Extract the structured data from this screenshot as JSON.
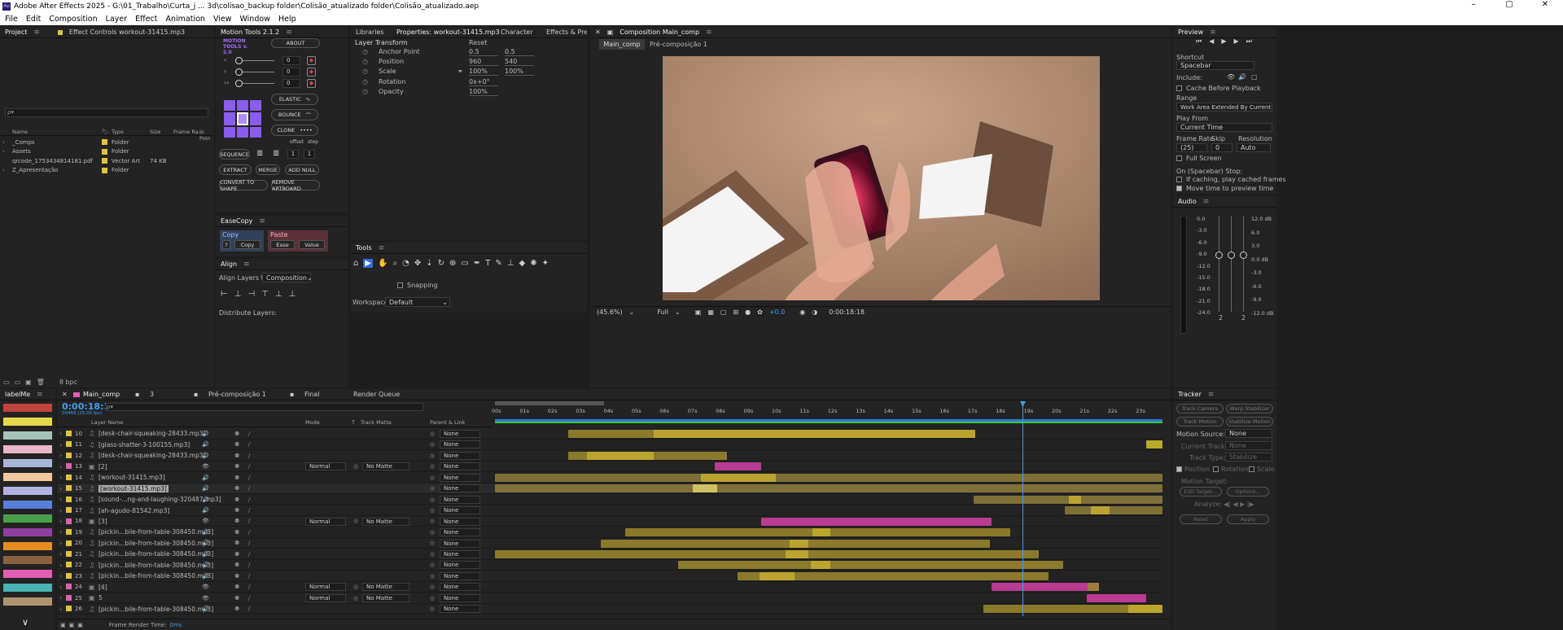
{
  "window": {
    "title": "Adobe After Effects 2025 - G:\\01_Trabalho\\Curta_j ... 3d\\colisao_backup folder\\Colisão_atualizado folder\\Colisão_atualizado.aep",
    "minimize": "–",
    "maximize": "▢",
    "close": "✕"
  },
  "menu": [
    "File",
    "Edit",
    "Composition",
    "Layer",
    "Effect",
    "Animation",
    "View",
    "Window",
    "Help"
  ],
  "project": {
    "tab": "Project",
    "tab2": "Effect Controls workout-31415.mp3",
    "search_placeholder": "ρ▾",
    "cols": [
      "Name",
      "Type",
      "Size",
      "Frame Ra...",
      "In Poin"
    ],
    "items": [
      {
        "name": "_Comps",
        "type": "Folder",
        "size": "",
        "color": "#e2c33a"
      },
      {
        "name": "Assets",
        "type": "Folder",
        "size": "",
        "color": "#e2c33a"
      },
      {
        "name": "qrcode_1753434814181.pdf",
        "type": "Vector Art",
        "size": "74 KB",
        "color": "#e2c33a"
      },
      {
        "name": "Z_Apresentação",
        "type": "Folder",
        "size": "",
        "color": "#e2c33a"
      }
    ],
    "bpc": "8 bpc"
  },
  "motion_tools": {
    "tab": "Motion Tools 2.1.2",
    "logo": "MOTION TOOLS v. 2.0",
    "about": "ABOUT",
    "val": "0",
    "elastic": "ELASTIC",
    "bounce": "BOUNCE",
    "clone": "CLONE",
    "offset": "offset",
    "step": "step",
    "sequence": "SEQUENCE",
    "one": "1",
    "extract": "EXTRACT",
    "merge": "MERGE",
    "add_null": "ADD NULL",
    "convert": "CONVERT TO SHAPE",
    "remove": "REMOVE ARTBOARD"
  },
  "easecopy": {
    "tab": "EaseCopy",
    "copy": "Copy",
    "q": "?",
    "copy_btn": "Copy",
    "paste": "Paste",
    "ease": "Ease",
    "value": "Value"
  },
  "align": {
    "tab": "Align",
    "align_to": "Align Layers to:",
    "target": "Composition",
    "distribute": "Distribute Layers:"
  },
  "properties": {
    "tabs": [
      "Libraries",
      "Properties: workout-31415.mp3",
      "Character",
      "Effects & Presets"
    ],
    "section": "Layer Transform",
    "reset": "Reset",
    "rows": [
      {
        "label": "Anchor Point",
        "v1": "0.5",
        "v2": "0.5"
      },
      {
        "label": "Position",
        "v1": "960",
        "v2": "540"
      },
      {
        "label": "Scale",
        "v1": "100%",
        "v2": "100%"
      },
      {
        "label": "Rotation",
        "v1": "0x+0°",
        "v2": ""
      },
      {
        "label": "Opacity",
        "v1": "100%",
        "v2": ""
      }
    ]
  },
  "tools": {
    "tab": "Tools",
    "snapping": "Snapping",
    "workspace_label": "Workspace:",
    "workspace": "Default"
  },
  "composition": {
    "tab": "Composition Main_comp",
    "crumb1": "Main_comp",
    "crumb2": "Pré-composição 1",
    "zoom": "(45.6%)",
    "res": "Full",
    "exposure": "+0.0",
    "time": "0:00:18:18"
  },
  "preview": {
    "tab": "Preview",
    "shortcut_label": "Shortcut",
    "shortcut": "Spacebar",
    "include": "Include:",
    "cache": "Cache Before Playback",
    "range_label": "Range",
    "range": "Work Area Extended By Current...",
    "playfrom_label": "Play From",
    "playfrom": "Current Time",
    "fr_label": "Frame Rate",
    "skip_label": "Skip",
    "res_label": "Resolution",
    "fr": "(25)",
    "skip": "0",
    "res": "Auto",
    "fullscreen": "Full Screen",
    "stop_label": "On (Spacebar) Stop:",
    "if_caching": "If caching, play cached frames",
    "move_time": "Move time to preview time"
  },
  "audio": {
    "tab": "Audio",
    "left": [
      "0.0",
      "-3.0",
      "-6.0",
      "-9.0",
      "-12.0",
      "-15.0",
      "-18.0",
      "-21.0",
      "-24.0"
    ],
    "right": [
      "12.0 dB",
      "6.0",
      "3.0",
      "0.0 dB",
      "-3.0",
      "-6.0",
      "-9.0",
      "-12.0 dB"
    ],
    "ch1": "2",
    "ch2": "2"
  },
  "tracker": {
    "tab": "Tracker",
    "track_camera": "Track Camera",
    "warp": "Warp Stabilizer",
    "track_motion": "Track Motion",
    "stabilize": "Stabilize Motion",
    "source_label": "Motion Source:",
    "source": "None",
    "current_label": "Current Track:",
    "current": "None",
    "type_label": "Track Type:",
    "type": "Stabilize",
    "position": "Position",
    "rotation": "Rotation",
    "scale": "Scale",
    "target": "Motion Target:",
    "edit_target": "Edit Target...",
    "options": "Options...",
    "analyze": "Analyze:",
    "reset": "Reset",
    "apply": "Apply"
  },
  "labels": {
    "tab": "labelMe",
    "colors": [
      "#c2423e",
      "#e5d84a",
      "#a6c3b8",
      "#e8b8c6",
      "#a9b7d6",
      "#f1c79e",
      "#b2b2e2",
      "#5a7edb",
      "#4a9f4a",
      "#8f3fa0",
      "#e48e22",
      "#8a6140",
      "#e25eb5",
      "#4ab3b5",
      "#b09470"
    ]
  },
  "timeline": {
    "tabs": [
      "Main_comp",
      "3",
      "Pré-composição 1",
      "Final",
      "Render Queue"
    ],
    "time": "0:00:18:18",
    "fps": "00468 (25.00 fps)",
    "cols": {
      "layer_name": "Layer Name",
      "mode": "Mode",
      "t": "T",
      "matte": "Track Matte",
      "parent": "Parent & Link"
    },
    "ruler": [
      "00s",
      "01s",
      "02s",
      "03s",
      "04s",
      "05s",
      "06s",
      "07s",
      "08s",
      "09s",
      "10s",
      "11s",
      "12s",
      "13s",
      "14s",
      "15s",
      "16s",
      "17s",
      "18s",
      "19s",
      "20s",
      "21s",
      "22s",
      "23s"
    ],
    "render_label": "Frame Render Time:",
    "render_time": "0ms",
    "layers": [
      {
        "num": "10",
        "name": "[desk-chair-squeaking-28433.mp3]",
        "color": "#e2c33a",
        "mode": "",
        "matte": "",
        "parent": "None"
      },
      {
        "num": "11",
        "name": "[glass-shatter-3-100155.mp3]",
        "color": "#e2c33a",
        "mode": "",
        "matte": "",
        "parent": "None"
      },
      {
        "num": "12",
        "name": "[desk-chair-squeaking-28433.mp3]",
        "color": "#e2c33a",
        "mode": "",
        "matte": "",
        "parent": "None"
      },
      {
        "num": "13",
        "name": "[2]",
        "color": "#e25eb5",
        "mode": "Normal",
        "matte": "No Matte",
        "parent": "None"
      },
      {
        "num": "14",
        "name": "[workout-31415.mp3]",
        "color": "#e2c33a",
        "mode": "",
        "matte": "",
        "parent": "None"
      },
      {
        "num": "15",
        "name": "[workout-31415.mp3]",
        "color": "#e2c33a",
        "mode": "",
        "matte": "",
        "parent": "None"
      },
      {
        "num": "16",
        "name": "[sound-...ng-and-laughing-320487.mp3]",
        "color": "#e2c33a",
        "mode": "",
        "matte": "",
        "parent": "None"
      },
      {
        "num": "17",
        "name": "[ah-agudo-81542.mp3]",
        "color": "#e2c33a",
        "mode": "",
        "matte": "",
        "parent": "None"
      },
      {
        "num": "18",
        "name": "[3]",
        "color": "#e25eb5",
        "mode": "Normal",
        "matte": "No Matte",
        "parent": "None"
      },
      {
        "num": "19",
        "name": "[pickin...bile-from-table-308450.mp3]",
        "color": "#e2c33a",
        "mode": "",
        "matte": "",
        "parent": "None"
      },
      {
        "num": "20",
        "name": "[pickin...bile-from-table-308450.mp3]",
        "color": "#e2c33a",
        "mode": "",
        "matte": "",
        "parent": "None"
      },
      {
        "num": "21",
        "name": "[pickin...bile-from-table-308450.mp3]",
        "color": "#e2c33a",
        "mode": "",
        "matte": "",
        "parent": "None"
      },
      {
        "num": "22",
        "name": "[pickin...bile-from-table-308450.mp3]",
        "color": "#e2c33a",
        "mode": "",
        "matte": "",
        "parent": "None"
      },
      {
        "num": "23",
        "name": "[pickin...bile-from-table-308450.mp3]",
        "color": "#e2c33a",
        "mode": "",
        "matte": "",
        "parent": "None"
      },
      {
        "num": "24",
        "name": "[4]",
        "color": "#e25eb5",
        "mode": "Normal",
        "matte": "No Matte",
        "parent": "None"
      },
      {
        "num": "25",
        "name": "5",
        "color": "#e25eb5",
        "mode": "Normal",
        "matte": "No Matte",
        "parent": "None"
      },
      {
        "num": "26",
        "name": "[pickin...bile-from-table-308450.mp3]",
        "color": "#e2c33a",
        "mode": "",
        "matte": "",
        "parent": "None"
      }
    ]
  }
}
